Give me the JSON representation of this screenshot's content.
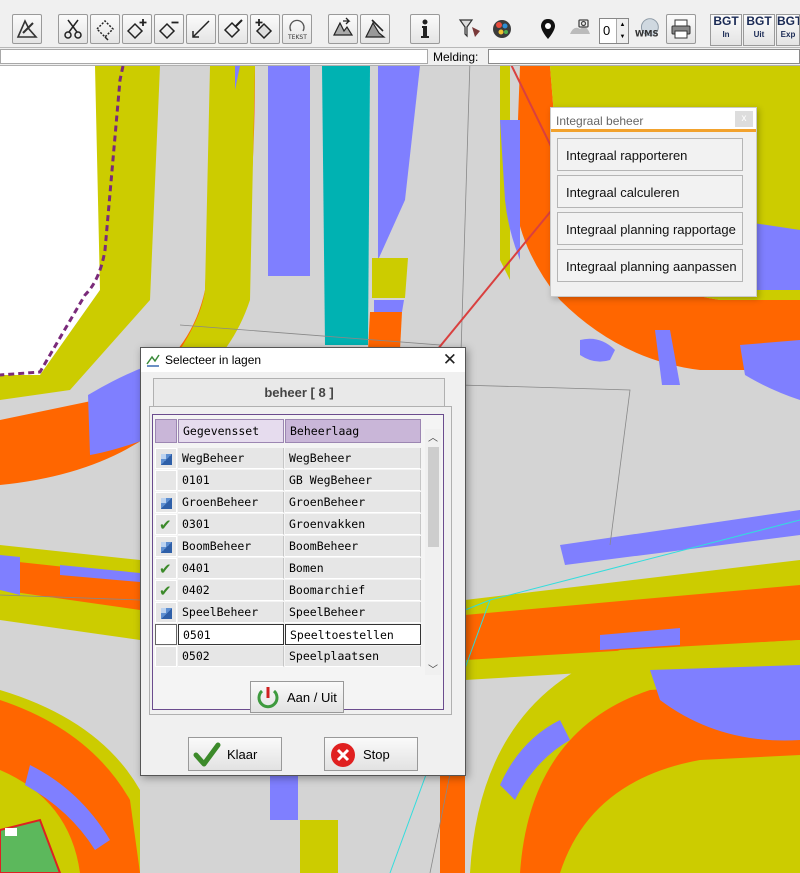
{
  "toolbar": {
    "buttons": [
      {
        "icon": "edit-map-icon"
      },
      {
        "icon": "cut-icon"
      },
      {
        "icon": "edit-polygon-icon"
      },
      {
        "icon": "add-vertex-icon"
      },
      {
        "icon": "remove-vertex-icon"
      },
      {
        "icon": "draw-line-icon"
      },
      {
        "icon": "edit-shape-icon"
      },
      {
        "icon": "add-shape-icon"
      },
      {
        "icon": "text-rotate-icon"
      },
      {
        "icon": "move-icon"
      },
      {
        "icon": "attribute-edit-icon"
      },
      {
        "icon": "info-icon"
      },
      {
        "icon": "filter-icon"
      },
      {
        "icon": "integraal-beheer-icon"
      },
      {
        "icon": "location-pin-icon"
      },
      {
        "icon": "camera-icon"
      },
      {
        "icon": "wms-icon"
      },
      {
        "icon": "print-icon"
      }
    ],
    "text_label": "TEKST",
    "wms_label": "WMS",
    "zoom_value": "0",
    "bgt_buttons": [
      {
        "label": "BGT",
        "sub": "In"
      },
      {
        "label": "BGT",
        "sub": "Uit"
      },
      {
        "label": "BGT",
        "sub": "Exp"
      }
    ]
  },
  "statusbar": {
    "melding_label": "Melding:",
    "melding_value": ""
  },
  "integraal_popup": {
    "title": "Integraal beheer",
    "close_label": "x",
    "items": [
      "Integraal rapporteren",
      "Integraal calculeren",
      "Integraal planning rapportage",
      "Integraal planning aanpassen"
    ]
  },
  "dialog": {
    "title": "Selecteer in lagen",
    "close_label": "✕",
    "tab_label": "beheer [ 8 ]",
    "columns": [
      "Gegevensset",
      "Beheerlaag"
    ],
    "rows": [
      {
        "marker": "group",
        "gegevensset": "WegBeheer",
        "beheerlaag": "WegBeheer"
      },
      {
        "marker": "none",
        "gegevensset": "0101",
        "beheerlaag": "GB WegBeheer"
      },
      {
        "marker": "group",
        "gegevensset": "GroenBeheer",
        "beheerlaag": "GroenBeheer"
      },
      {
        "marker": "check",
        "gegevensset": "0301",
        "beheerlaag": "Groenvakken"
      },
      {
        "marker": "group",
        "gegevensset": "BoomBeheer",
        "beheerlaag": "BoomBeheer"
      },
      {
        "marker": "check",
        "gegevensset": "0401",
        "beheerlaag": "Bomen"
      },
      {
        "marker": "check",
        "gegevensset": "0402",
        "beheerlaag": "Boomarchief"
      },
      {
        "marker": "group",
        "gegevensset": "SpeelBeheer",
        "beheerlaag": "SpeelBeheer"
      },
      {
        "marker": "active",
        "gegevensset": "0501",
        "beheerlaag": "Speeltoestellen"
      },
      {
        "marker": "none",
        "gegevensset": "0502",
        "beheerlaag": "Speelplaatsen"
      }
    ],
    "toggle_label": "Aan / Uit",
    "ok_label": "Klaar",
    "stop_label": "Stop"
  },
  "colors": {
    "road_orange": "#ff6600",
    "berm_yellow": "#cccc00",
    "path_blue": "#7f7fff",
    "teal": "#00b2b2",
    "pavement_gray": "#d4d4d4",
    "grid_header": "#c9b6d8",
    "popup_accent": "#f2a22d",
    "arrow_red": "#d9403f"
  }
}
